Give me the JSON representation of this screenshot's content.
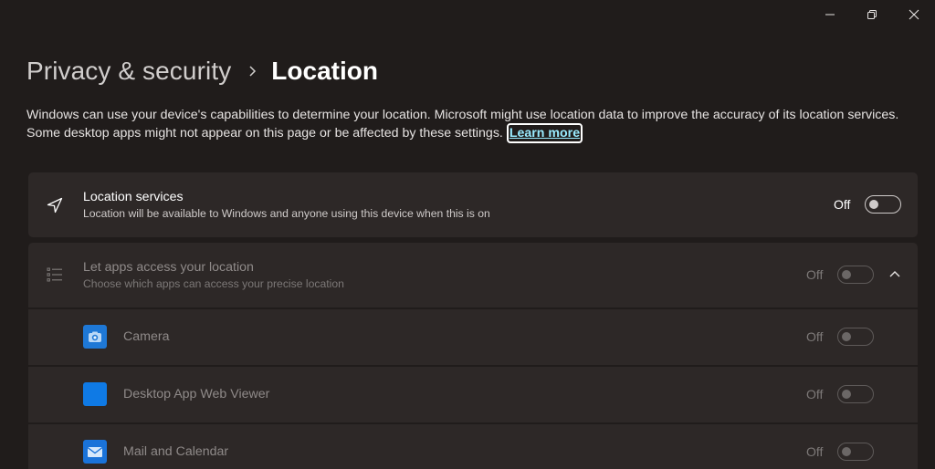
{
  "window": {
    "minimize_icon": "minimize-icon",
    "restore_icon": "restore-icon",
    "close_icon": "close-icon"
  },
  "header": {
    "parent": "Privacy & security",
    "separator_icon": "chevron-right-icon",
    "current": "Location"
  },
  "description": {
    "text": "Windows can use your device's capabilities to determine your location. Microsoft might use location data to improve the accuracy of its location services. Some desktop apps might not appear on this page or be affected by these settings.",
    "link": "Learn more"
  },
  "location_services": {
    "icon": "navigation-arrow-icon",
    "title": "Location services",
    "subtitle": "Location will be available to Windows and anyone using this device when this is on",
    "state": "Off"
  },
  "app_access": {
    "icon": "list-icon",
    "title": "Let apps access your location",
    "subtitle": "Choose which apps can access your precise location",
    "state": "Off",
    "chevron_icon": "chevron-up-icon"
  },
  "apps": [
    {
      "label": "Camera",
      "state": "Off",
      "icon": "camera-app-icon",
      "color": "#1e78d6"
    },
    {
      "label": "Desktop App Web Viewer",
      "state": "Off",
      "icon": "web-viewer-app-icon",
      "color": "#0f7ae5"
    },
    {
      "label": "Mail and Calendar",
      "state": "Off",
      "icon": "mail-app-icon",
      "color": "#1a73d9"
    }
  ],
  "colors": {
    "background": "#201c1b",
    "card": "#2d2827",
    "link": "#99ebff"
  }
}
